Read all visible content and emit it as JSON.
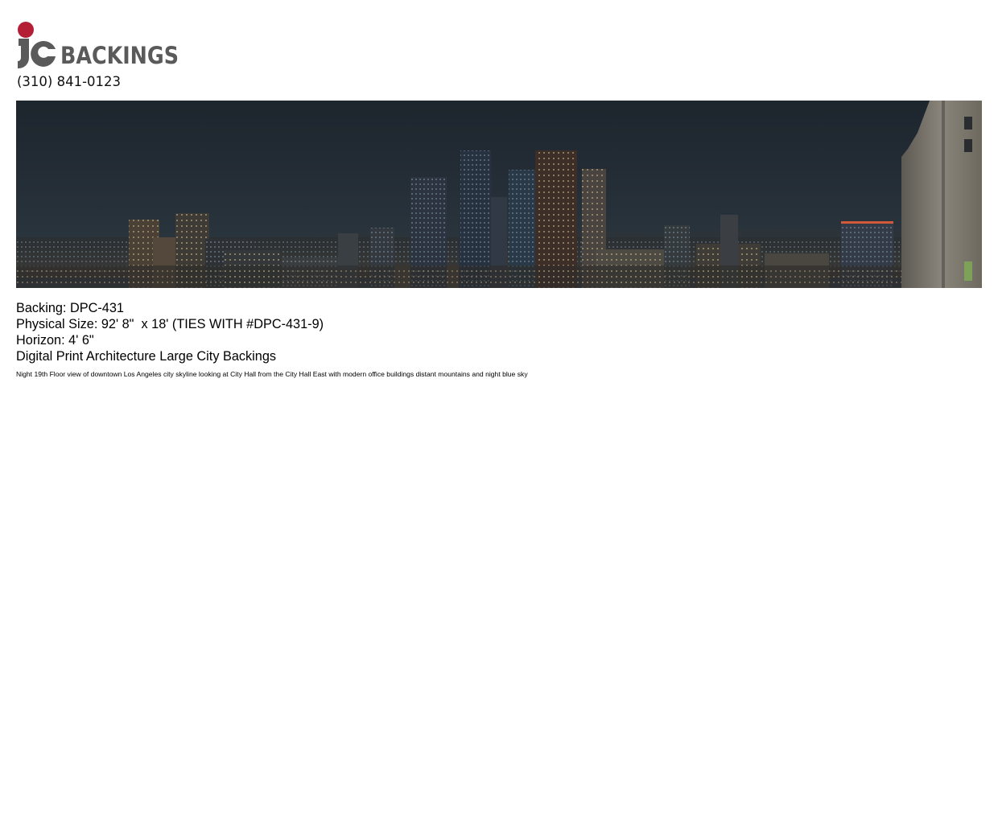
{
  "brand": {
    "logo_text": "BACKINGS",
    "logo_mark": "jc",
    "phone": "(310) 841-0123",
    "colors": {
      "dot": "#b51f35",
      "mark": "#5a5a5a",
      "wordmark": "#5a5a5a"
    }
  },
  "hero": {
    "icon": "city-skyline-night-image"
  },
  "details": {
    "backing": "Backing: DPC-431",
    "physical_size": "Physical Size: 92' 8\"  x 18' (TIES WITH #DPC-431-9)",
    "horizon": "Horizon: 4' 6\"",
    "category": "Digital Print Architecture Large City Backings",
    "description": "Night 19th Floor view of downtown Los Angeles city skyline looking at City Hall from the City Hall East with modern office buildings distant mountains and night blue sky"
  }
}
